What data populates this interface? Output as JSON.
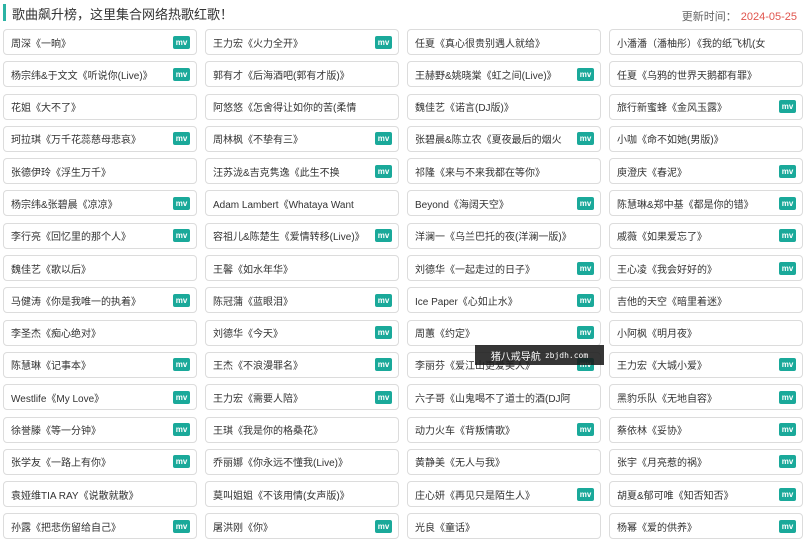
{
  "header": {
    "title": "歌曲飙升榜，这里集合网络热歌红歌！",
    "update_label": "更新时间：",
    "update_date": "2024-05-25"
  },
  "mv_label": "mv",
  "colors": {
    "accent": "#2bb3a4",
    "mv_badge": "#1aa99a",
    "date": "#e0544d"
  },
  "songs": [
    {
      "title": "周深《一晌》",
      "mv": true
    },
    {
      "title": "王力宏《火力全开》",
      "mv": true
    },
    {
      "title": "任夏《真心很贵别遇人就给》",
      "mv": false
    },
    {
      "title": "小潘潘（潘柚彤）《我的纸飞机(女",
      "mv": false
    },
    {
      "title": "杨宗纬&于文文《听说你(Live)》",
      "mv": true
    },
    {
      "title": "郭有才《后海酒吧(郭有才版)》",
      "mv": false
    },
    {
      "title": "王赫野&姚晓棠《虹之间(Live)》",
      "mv": true
    },
    {
      "title": "任夏《乌鸦的世界天鹅都有罪》",
      "mv": false
    },
    {
      "title": "花姐《大不了》",
      "mv": false
    },
    {
      "title": "阿悠悠《怎舍得让如你的苦(柔情",
      "mv": false
    },
    {
      "title": "魏佳艺《诺言(DJ版)》",
      "mv": false
    },
    {
      "title": "旅行新蜜蜂《金风玉露》",
      "mv": true
    },
    {
      "title": "珂拉琪《万千花蕊慈母悲哀》",
      "mv": true
    },
    {
      "title": "周林枫《不挚有三》",
      "mv": true
    },
    {
      "title": "张碧晨&陈立农《夏夜最后的烟火",
      "mv": true
    },
    {
      "title": "小咖《命不如她(男版)》",
      "mv": false
    },
    {
      "title": "张德伊玲《浮生万千》",
      "mv": false
    },
    {
      "title": "汪苏泷&吉克隽逸《此生不换",
      "mv": true
    },
    {
      "title": "祁隆《来与不来我都在等你》",
      "mv": false
    },
    {
      "title": "庾澄庆《春泥》",
      "mv": true
    },
    {
      "title": "杨宗纬&张碧晨《凉凉》",
      "mv": true
    },
    {
      "title": "Adam Lambert《Whataya Want",
      "mv": false
    },
    {
      "title": "Beyond《海阔天空》",
      "mv": true
    },
    {
      "title": "陈慧琳&郑中基《都是你的错》",
      "mv": true
    },
    {
      "title": "李行亮《回忆里的那个人》",
      "mv": true
    },
    {
      "title": "容祖儿&陈楚生《爱情转移(Live)》",
      "mv": true
    },
    {
      "title": "洋澜一《乌兰巴托的夜(洋澜一版)》",
      "mv": false
    },
    {
      "title": "戚薇《如果爱忘了》",
      "mv": true
    },
    {
      "title": "魏佳艺《歌以后》",
      "mv": false
    },
    {
      "title": "王馨《如水年华》",
      "mv": false
    },
    {
      "title": "刘德华《一起走过的日子》",
      "mv": true
    },
    {
      "title": "王心凌《我会好好的》",
      "mv": true
    },
    {
      "title": "马健涛《你是我唯一的执着》",
      "mv": true
    },
    {
      "title": "陈冠蒲《蓝眼泪》",
      "mv": true
    },
    {
      "title": "Ice Paper《心如止水》",
      "mv": true
    },
    {
      "title": "吉他的天空《暗里着迷》",
      "mv": false
    },
    {
      "title": "李圣杰《痴心绝对》",
      "mv": false
    },
    {
      "title": "刘德华《今天》",
      "mv": true
    },
    {
      "title": "周蕙《约定》",
      "mv": true
    },
    {
      "title": "小阿枫《明月夜》",
      "mv": false
    },
    {
      "title": "陈慧琳《记事本》",
      "mv": true
    },
    {
      "title": "王杰《不浪漫罪名》",
      "mv": true
    },
    {
      "title": "李丽芬《爱江山更爱美人》",
      "mv": true
    },
    {
      "title": "王力宏《大城小爱》",
      "mv": true
    },
    {
      "title": "Westlife《My Love》",
      "mv": true
    },
    {
      "title": "王力宏《需要人陪》",
      "mv": true
    },
    {
      "title": "六子哥《山鬼喝不了道士的酒(DJ阿",
      "mv": false
    },
    {
      "title": "黑豹乐队《无地自容》",
      "mv": true
    },
    {
      "title": "徐誉滕《等一分钟》",
      "mv": true
    },
    {
      "title": "王琪《我是你的格桑花》",
      "mv": false
    },
    {
      "title": "动力火车《背叛情歌》",
      "mv": true
    },
    {
      "title": "蔡依林《妥协》",
      "mv": true
    },
    {
      "title": "张学友《一路上有你》",
      "mv": true
    },
    {
      "title": "乔丽娜《你永远不懂我(Live)》",
      "mv": false
    },
    {
      "title": "黄静美《无人与我》",
      "mv": false
    },
    {
      "title": "张宇《月亮惹的祸》",
      "mv": true
    },
    {
      "title": "袁娅维TIA RAY《说散就散》",
      "mv": false
    },
    {
      "title": "莫叫姐姐《不该用情(女声版)》",
      "mv": false
    },
    {
      "title": "庄心妍《再见只是陌生人》",
      "mv": true
    },
    {
      "title": "胡夏&郁可唯《知否知否》",
      "mv": true
    },
    {
      "title": "孙露《把悲伤留给自己》",
      "mv": true
    },
    {
      "title": "屠洪刚《你》",
      "mv": true
    },
    {
      "title": "光良《童话》",
      "mv": false
    },
    {
      "title": "杨幂《爱的供养》",
      "mv": true
    }
  ],
  "watermark": {
    "text": "猪八戒导航",
    "url": "zbjdh.com"
  }
}
